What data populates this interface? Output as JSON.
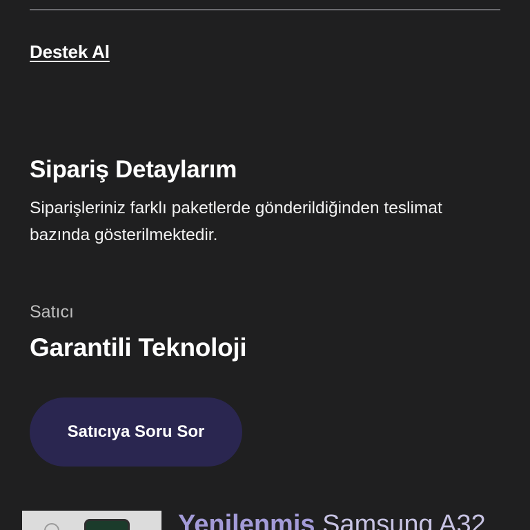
{
  "support": {
    "link_label": "Destek Al"
  },
  "order_details": {
    "title": "Sipariş Detaylarım",
    "description": "Siparişleriniz farklı paketlerde gönderildiğinden teslimat bazında gösterilmektedir."
  },
  "seller": {
    "label": "Satıcı",
    "name": "Garantili Teknoloji",
    "ask_button_label": "Satıcıya Soru Sor"
  },
  "product": {
    "tag": "Yenilenmiş",
    "name": "Samsung A32"
  },
  "colors": {
    "background": "#1f1f20",
    "button": "#2a2650",
    "accent_text": "#a39bd8"
  }
}
